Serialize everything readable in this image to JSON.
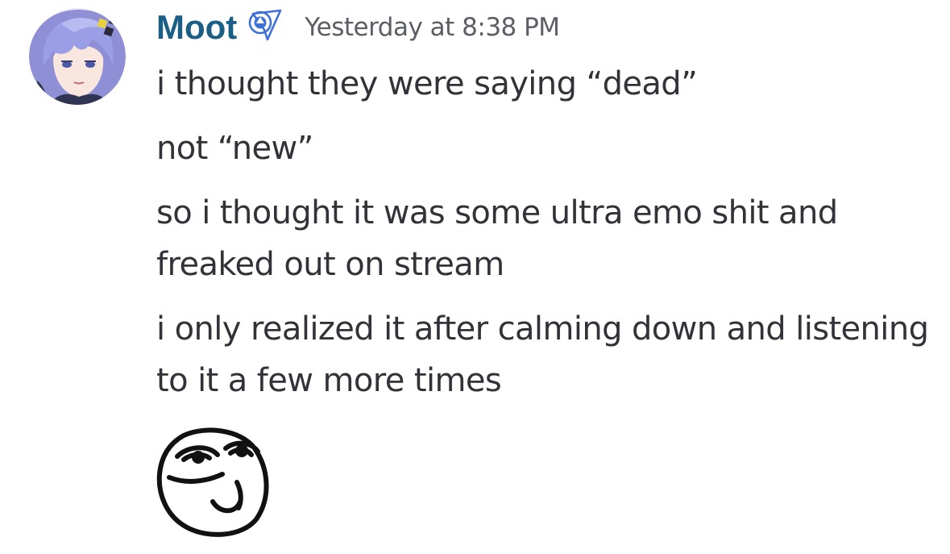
{
  "message": {
    "author": "Moot",
    "timestamp": "Yesterday at 8:38 PM",
    "badge_icon": "nitro-badge-icon",
    "username_color": "#1b5f86",
    "lines": [
      "i thought they were saying “dead”",
      "not “new”",
      "so i thought it was some ultra emo shit and freaked out on stream",
      "i only realized it after calming down and listening to it a few more times"
    ],
    "attachment": {
      "type": "emoji",
      "icon": "smug-face-emoji"
    }
  }
}
